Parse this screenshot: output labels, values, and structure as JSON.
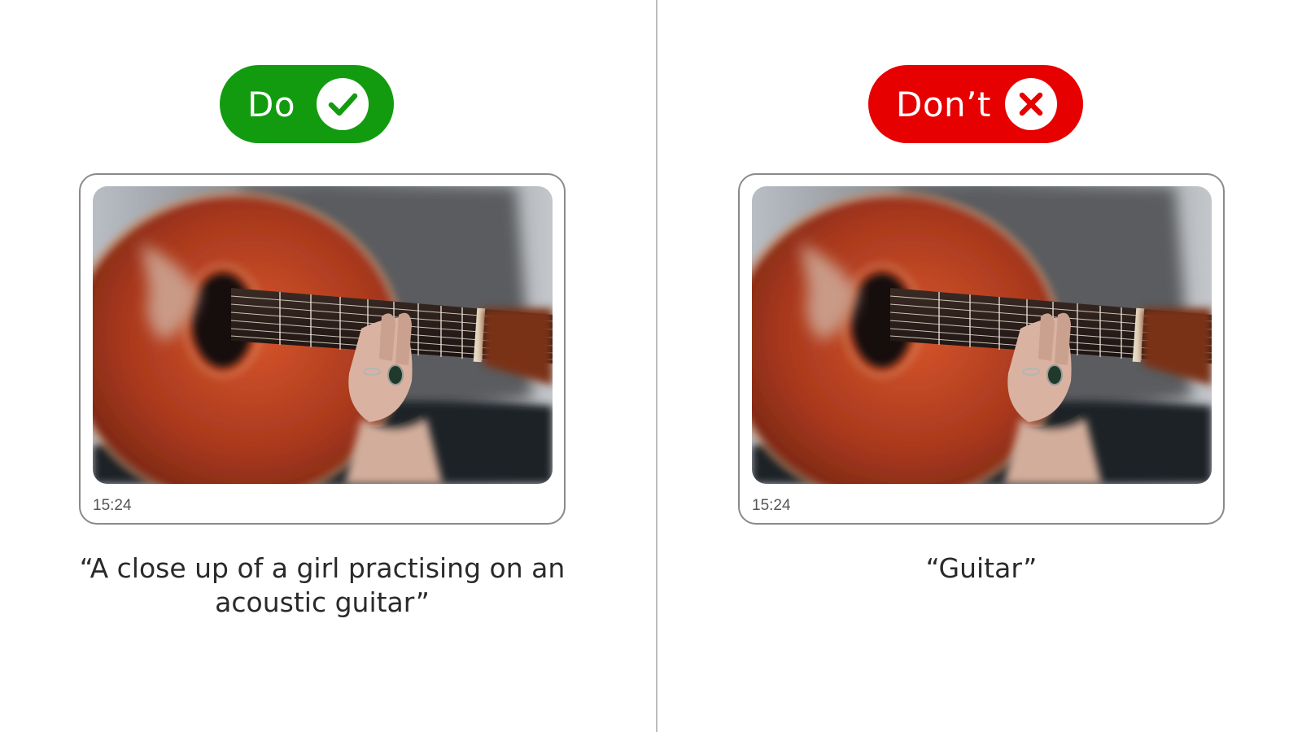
{
  "do_panel": {
    "badge": {
      "label": "Do",
      "color": "#139b10",
      "icon": "check-icon"
    },
    "message": {
      "time": "15:24"
    },
    "caption": "“A close up of a girl practising on an acoustic guitar”"
  },
  "dont_panel": {
    "badge": {
      "label": "Don’t",
      "color": "#e60000",
      "icon": "cross-icon"
    },
    "message": {
      "time": "15:24"
    },
    "caption": "“Guitar”"
  }
}
